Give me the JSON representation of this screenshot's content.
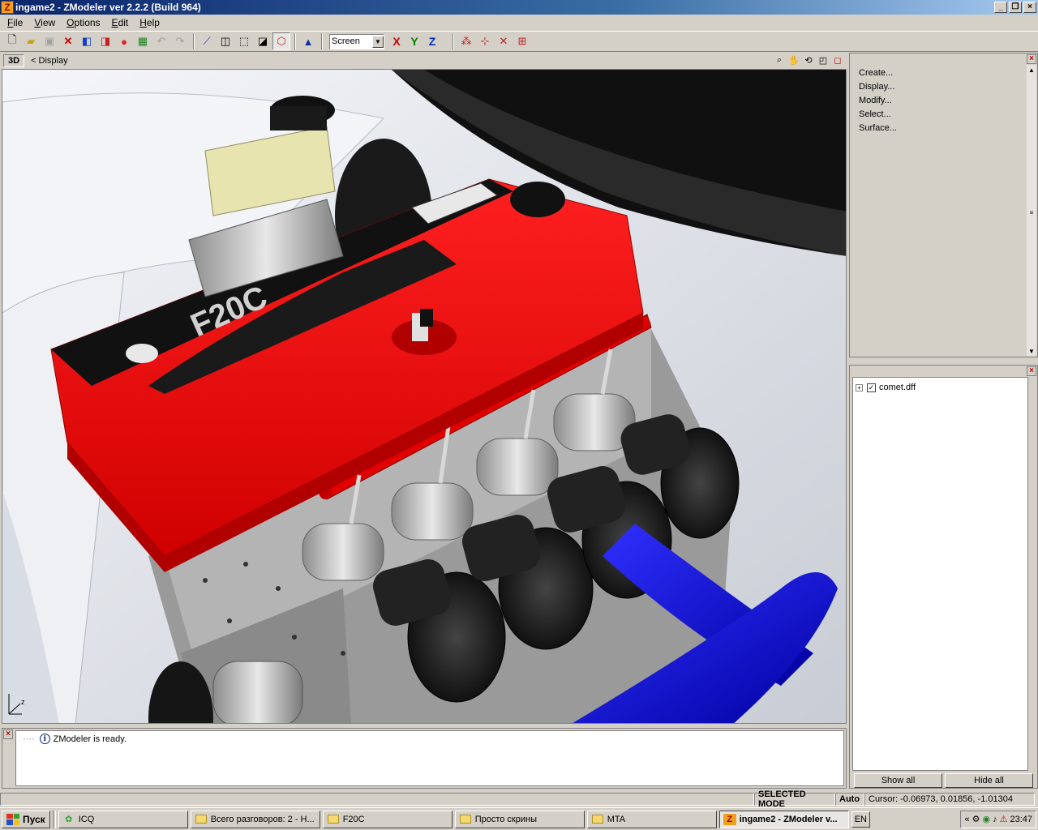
{
  "window": {
    "title": "ingame2 - ZModeler ver 2.2.2 (Build 964)",
    "minimize": "_",
    "maximize": "❐",
    "close": "×"
  },
  "menu": [
    "File",
    "View",
    "Options",
    "Edit",
    "Help"
  ],
  "toolbar": {
    "coord_system": "Screen",
    "axis_x": "X",
    "axis_y": "Y",
    "axis_z": "Z"
  },
  "viewport": {
    "view_badge": "3D",
    "view_label": "< Display",
    "axis_z": "z"
  },
  "commands": [
    "Create...",
    "Display...",
    "Modify...",
    "Select...",
    "Surface..."
  ],
  "objects": {
    "tree": [
      {
        "name": "comet.dff",
        "checked": true
      }
    ],
    "show_all": "Show all",
    "hide_all": "Hide all"
  },
  "log": {
    "message": "ZModeler is ready."
  },
  "status": {
    "mode": "SELECTED MODE",
    "snap": "Auto",
    "cursor": "Cursor: -0.06973, 0.01856, -1.01304"
  },
  "taskbar": {
    "start": "Пуск",
    "tasks": [
      "ICQ",
      "Всего разговоров: 2 - Н...",
      "F20C",
      "Просто скрины",
      "MTA",
      "ingame2 - ZModeler v..."
    ],
    "lang": "EN",
    "clock": "23:47"
  },
  "colors": {
    "valve_cover": "#ff0000",
    "pipe": "#0000e0",
    "title_start": "#0a246a"
  },
  "icons": [
    "new-icon",
    "open-icon",
    "save-icon",
    "delete-icon",
    "import-icon",
    "export-icon",
    "render-icon",
    "screenshot-icon",
    "undo-icon",
    "redo-icon",
    "vertex-icon",
    "cube-icon",
    "wire-cube-icon",
    "solid-cube-icon",
    "hide-icon",
    "move-icon",
    "zoom-icon",
    "pan-icon",
    "rotate-icon",
    "maximize-icon"
  ]
}
